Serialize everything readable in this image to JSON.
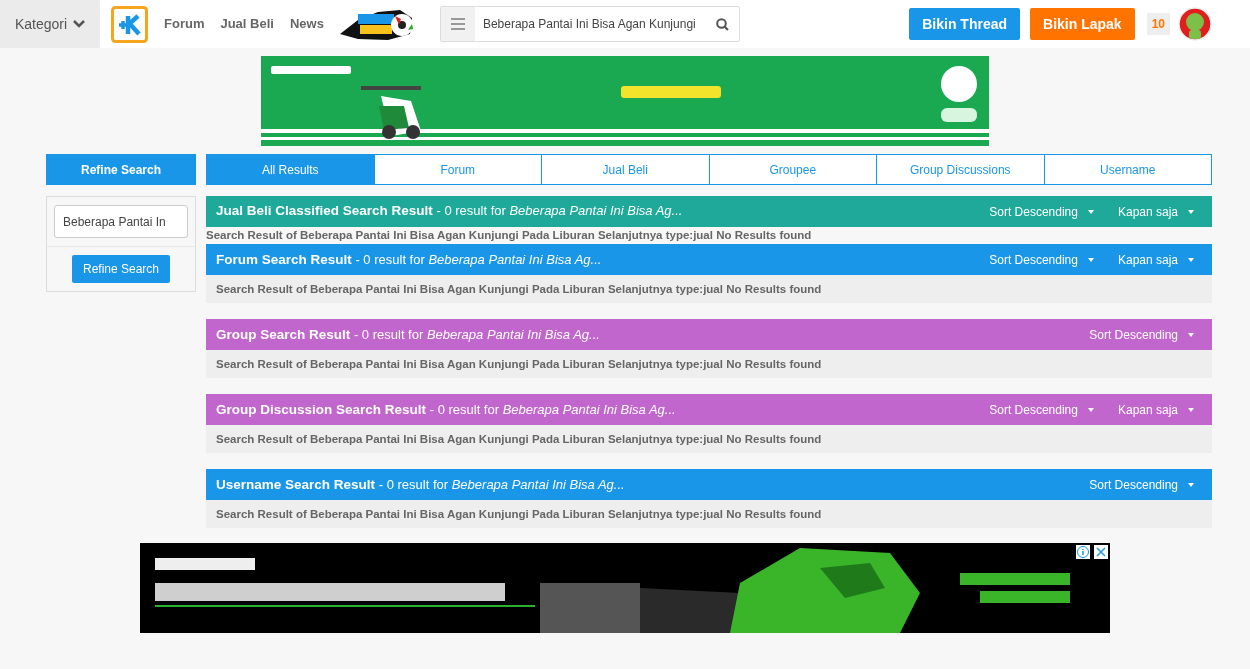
{
  "header": {
    "category_button": "Kategori",
    "nav": [
      "Forum",
      "Jual Beli",
      "News"
    ],
    "search": {
      "value": "Beberapa Pantai Ini Bisa Agan Kunjungi"
    },
    "buttons": [
      {
        "label": "Bikin Thread",
        "color": "#1a96e8"
      },
      {
        "label": "Bikin Lapak",
        "color": "#ff7400"
      }
    ],
    "notification_count": "10"
  },
  "sidebar": {
    "title": "Refine Search",
    "field": {
      "value": "Beberapa Pantai In"
    },
    "button": "Refine Search"
  },
  "tabs": [
    {
      "label": "All Results",
      "selected": true
    },
    {
      "label": "Forum",
      "selected": false
    },
    {
      "label": "Jual Beli",
      "selected": false
    },
    {
      "label": "Groupee",
      "selected": false
    },
    {
      "label": "Group Discussions",
      "selected": false
    },
    {
      "label": "Username",
      "selected": false
    }
  ],
  "sections": [
    {
      "title": "Jual Beli Classified Search Result",
      "count": "- 0 result for",
      "query": "Beberapa Pantai Ini Bisa Ag...",
      "color": "#1ea99b",
      "filters": [
        "Sort Descending",
        "Kapan saja"
      ],
      "kind": "plain",
      "message": "Search Result of Beberapa Pantai Ini Bisa Agan Kunjungi Pada Liburan Selanjutnya type:jual No Results found"
    },
    {
      "title": "Forum Search Result",
      "count": "- 0 result for",
      "query": "Beberapa Pantai Ini Bisa Ag...",
      "color": "#1a96e8",
      "filters": [
        "Sort Descending",
        "Kapan saja"
      ],
      "kind": "boxed",
      "message": "Search Result of Beberapa Pantai Ini Bisa Agan Kunjungi Pada Liburan Selanjutnya type:jual No Results found"
    },
    {
      "title": "Group Search Result",
      "count": "- 0 result for",
      "query": "Beberapa Pantai Ini Bisa Ag...",
      "color": "#c066cc",
      "filters": [
        "Sort Descending"
      ],
      "kind": "boxed",
      "message": "Search Result of Beberapa Pantai Ini Bisa Agan Kunjungi Pada Liburan Selanjutnya type:jual No Results found"
    },
    {
      "title": "Group Discussion Search Result",
      "count": "- 0 result for",
      "query": "Beberapa Pantai Ini Bisa Ag...",
      "color": "#c066cc",
      "filters": [
        "Sort Descending",
        "Kapan saja"
      ],
      "kind": "boxed",
      "message": "Search Result of Beberapa Pantai Ini Bisa Agan Kunjungi Pada Liburan Selanjutnya type:jual No Results found"
    },
    {
      "title": "Username Search Result",
      "count": "- 0 result for",
      "query": "Beberapa Pantai Ini Bisa Ag...",
      "color": "#1a96e8",
      "filters": [
        "Sort Descending"
      ],
      "kind": "boxed",
      "message": "Search Result of Beberapa Pantai Ini Bisa Agan Kunjungi Pada Liburan Selanjutnya type:jual No Results found"
    }
  ]
}
